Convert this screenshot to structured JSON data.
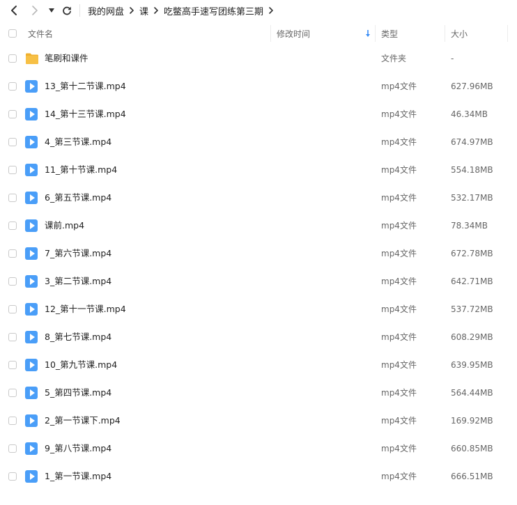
{
  "breadcrumb": [
    "我的网盘",
    "课",
    "吃鳖高手速写团练第三期"
  ],
  "columns": {
    "name": "文件名",
    "modified": "修改时间",
    "type": "类型",
    "size": "大小"
  },
  "files": [
    {
      "name": "笔刷和课件",
      "type": "文件夹",
      "size": "-",
      "icon": "folder-icon"
    },
    {
      "name": "13_第十二节课.mp4",
      "type": "mp4文件",
      "size": "627.96MB",
      "icon": "video-icon"
    },
    {
      "name": "14_第十三节课.mp4",
      "type": "mp4文件",
      "size": "46.34MB",
      "icon": "video-icon"
    },
    {
      "name": "4_第三节课.mp4",
      "type": "mp4文件",
      "size": "674.97MB",
      "icon": "video-icon"
    },
    {
      "name": "11_第十节课.mp4",
      "type": "mp4文件",
      "size": "554.18MB",
      "icon": "video-icon"
    },
    {
      "name": "6_第五节课.mp4",
      "type": "mp4文件",
      "size": "532.17MB",
      "icon": "video-icon"
    },
    {
      "name": "课前.mp4",
      "type": "mp4文件",
      "size": "78.34MB",
      "icon": "video-icon"
    },
    {
      "name": "7_第六节课.mp4",
      "type": "mp4文件",
      "size": "672.78MB",
      "icon": "video-icon"
    },
    {
      "name": "3_第二节课.mp4",
      "type": "mp4文件",
      "size": "642.71MB",
      "icon": "video-icon"
    },
    {
      "name": "12_第十一节课.mp4",
      "type": "mp4文件",
      "size": "537.72MB",
      "icon": "video-icon"
    },
    {
      "name": "8_第七节课.mp4",
      "type": "mp4文件",
      "size": "608.29MB",
      "icon": "video-icon"
    },
    {
      "name": "10_第九节课.mp4",
      "type": "mp4文件",
      "size": "639.95MB",
      "icon": "video-icon"
    },
    {
      "name": "5_第四节课.mp4",
      "type": "mp4文件",
      "size": "564.44MB",
      "icon": "video-icon"
    },
    {
      "name": "2_第一节课下.mp4",
      "type": "mp4文件",
      "size": "169.92MB",
      "icon": "video-icon"
    },
    {
      "name": "9_第八节课.mp4",
      "type": "mp4文件",
      "size": "660.85MB",
      "icon": "video-icon"
    },
    {
      "name": "1_第一节课.mp4",
      "type": "mp4文件",
      "size": "666.51MB",
      "icon": "video-icon"
    }
  ],
  "colors": {
    "accent": "#4a9ef8",
    "folder": "#f7c045",
    "folder_dark": "#f0b02e"
  }
}
